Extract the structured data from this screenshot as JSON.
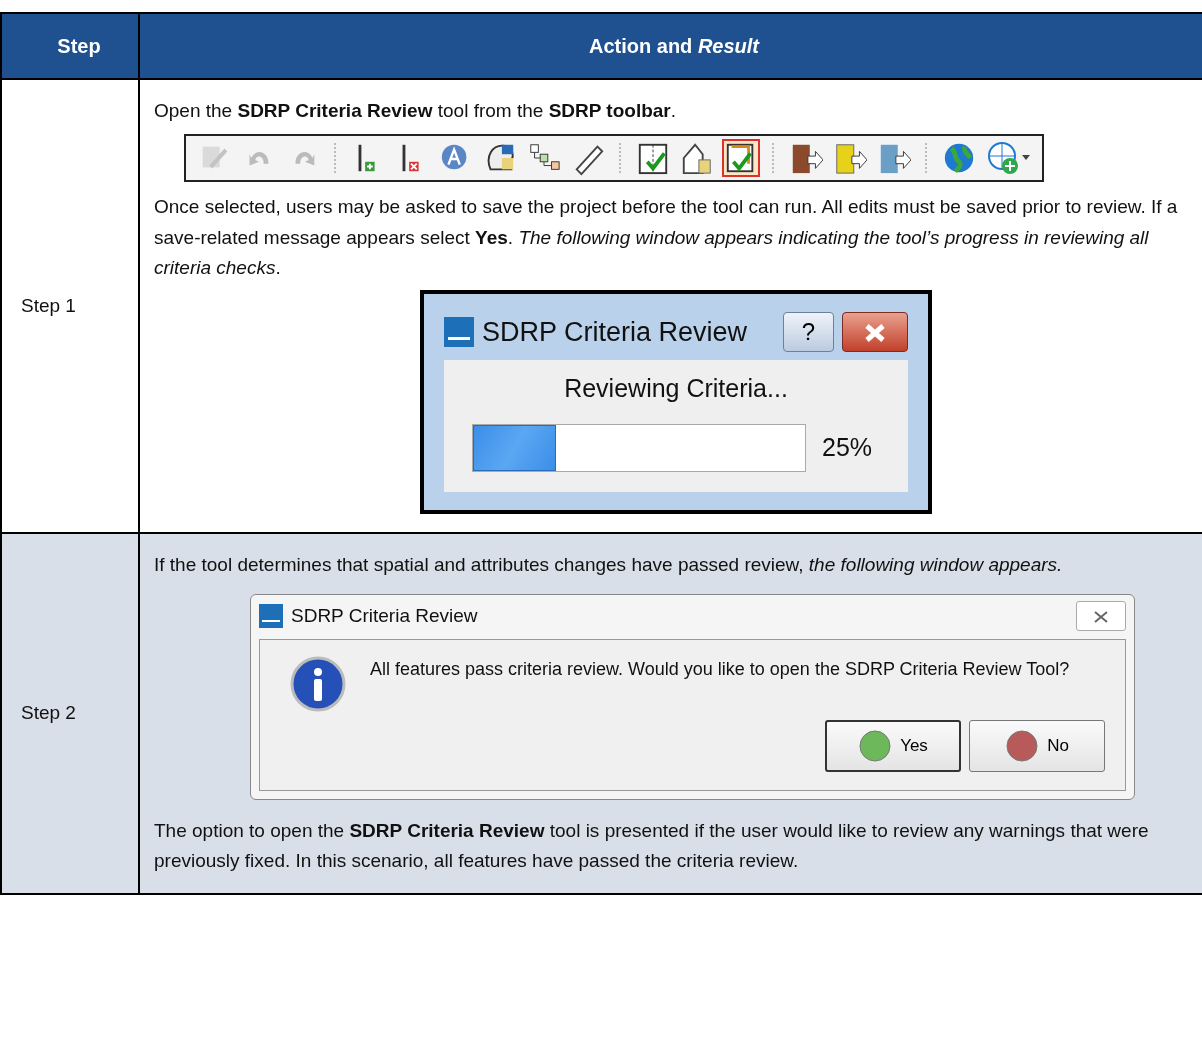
{
  "table": {
    "columns": [
      "Step",
      "Action and *Result*"
    ],
    "rows": [
      {
        "step": "Step 1",
        "blocks": [
          {
            "kind": "paragraph",
            "text": "Open the **SDRP Criteria Review** tool from the **SDRP toolbar**."
          },
          {
            "kind": "toolbar",
            "tools": [
              {
                "disabled": true,
                "selected": false
              },
              {
                "disabled": true,
                "selected": false
              },
              {
                "disabled": true,
                "selected": false
              },
              {
                "disabled": false,
                "selected": false
              },
              {
                "disabled": false,
                "selected": false
              },
              {
                "disabled": false,
                "selected": false
              },
              {
                "disabled": false,
                "selected": false
              },
              {
                "disabled": false,
                "selected": false
              },
              {
                "disabled": false,
                "selected": false
              },
              {
                "disabled": false,
                "selected": false
              },
              {
                "disabled": false,
                "selected": false
              },
              {
                "disabled": false,
                "selected": true
              },
              {
                "disabled": false,
                "selected": false
              },
              {
                "disabled": false,
                "selected": false
              },
              {
                "disabled": false,
                "selected": false
              },
              {
                "disabled": false,
                "selected": false
              },
              {
                "disabled": false,
                "selected": false
              }
            ]
          },
          {
            "kind": "paragraph",
            "text": "Once selected, users may be asked to save the project before the tool can run. All edits must be saved prior to review. If a save-related message appears select **Yes**. *The following window appears indicating the tool’s progress in reviewing all criteria checks*."
          },
          {
            "kind": "progress_dialog",
            "title": "SDRP Criteria Review",
            "help": "?",
            "message": "Reviewing Criteria...",
            "level": 0.25,
            "reading": "25%"
          }
        ]
      },
      {
        "step": "Step 2",
        "blocks": [
          {
            "kind": "paragraph",
            "text": "If the tool determines that spatial and attributes changes have passed review, *the following window appears.*"
          },
          {
            "kind": "message_dialog",
            "title": "SDRP Criteria Review",
            "message": "All features pass criteria review. Would you like to open the SDRP Criteria Review Tool?",
            "buttons": [
              {
                "label": "Yes",
                "default": true
              },
              {
                "label": "No",
                "default": false
              }
            ]
          },
          {
            "kind": "paragraph",
            "text": "The option to open the **SDRP Criteria Review** tool is presented if the user would like to review any warnings that were previously fixed. In this scenario, all features have passed the criteria review."
          }
        ]
      }
    ]
  }
}
